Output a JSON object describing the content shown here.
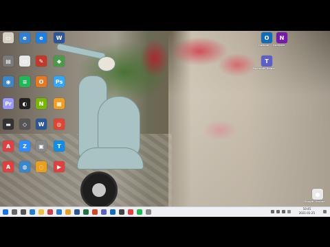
{
  "desktop": {
    "icons_left": [
      {
        "name": "app-icon-1",
        "label": "",
        "color": "#d8d2c6",
        "glyph": "▭"
      },
      {
        "name": "app-icon-2",
        "label": "",
        "color": "#2f7fd3",
        "glyph": "e"
      },
      {
        "name": "app-icon-3",
        "label": "",
        "color": "#1e7fe0",
        "glyph": "e"
      },
      {
        "name": "app-icon-4",
        "label": "",
        "color": "#2b579a",
        "glyph": "W"
      },
      {
        "name": "app-icon-5",
        "label": "",
        "color": "#7a7a7a",
        "glyph": "▤"
      },
      {
        "name": "app-icon-6",
        "label": "",
        "color": "#e8e8e8",
        "glyph": "▭"
      },
      {
        "name": "app-icon-7",
        "label": "",
        "color": "#c0392b",
        "glyph": "✎"
      },
      {
        "name": "app-icon-8",
        "label": "",
        "color": "#4a9a4a",
        "glyph": "◆"
      },
      {
        "name": "app-icon-9",
        "label": "",
        "color": "#3a86c8",
        "glyph": "◉"
      },
      {
        "name": "app-icon-10",
        "label": "",
        "color": "#1db954",
        "glyph": "≡"
      },
      {
        "name": "app-icon-11",
        "label": "",
        "color": "#e87722",
        "glyph": "O"
      },
      {
        "name": "app-icon-12",
        "label": "",
        "color": "#31a8ff",
        "glyph": "Ps"
      },
      {
        "name": "app-icon-13",
        "label": "",
        "color": "#9999ff",
        "glyph": "Pr"
      },
      {
        "name": "app-icon-14",
        "label": "",
        "color": "#222",
        "glyph": "◐"
      },
      {
        "name": "app-icon-15",
        "label": "",
        "color": "#76b900",
        "glyph": "N"
      },
      {
        "name": "app-icon-16",
        "label": "",
        "color": "#f0a020",
        "glyph": "▦"
      },
      {
        "name": "app-icon-17",
        "label": "",
        "color": "#333",
        "glyph": "▬"
      },
      {
        "name": "app-icon-18",
        "label": "",
        "color": "#555",
        "glyph": "◇"
      },
      {
        "name": "app-icon-19",
        "label": "",
        "color": "#2b579a",
        "glyph": "W"
      },
      {
        "name": "app-icon-20",
        "label": "",
        "color": "#e0452f",
        "glyph": "◎"
      },
      {
        "name": "app-icon-21",
        "label": "",
        "color": "#e04040",
        "glyph": "A"
      },
      {
        "name": "app-icon-22",
        "label": "",
        "color": "#2d8cff",
        "glyph": "Z"
      },
      {
        "name": "app-icon-23",
        "label": "",
        "color": "#888",
        "glyph": "▣"
      },
      {
        "name": "app-icon-24",
        "label": "",
        "color": "#0e8ee9",
        "glyph": "T"
      },
      {
        "name": "app-icon-25",
        "label": "",
        "color": "#e04040",
        "glyph": "A"
      },
      {
        "name": "app-icon-26",
        "label": "",
        "color": "#3a86c8",
        "glyph": "◍"
      },
      {
        "name": "app-icon-27",
        "label": "",
        "color": "#e8a020",
        "glyph": "◌"
      },
      {
        "name": "app-icon-28",
        "label": "",
        "color": "#e04040",
        "glyph": "▶"
      }
    ],
    "icons_right": [
      {
        "name": "outlook-icon",
        "label": "Outlook",
        "color": "#0f6cbd",
        "glyph": "O"
      },
      {
        "name": "onenote-icon",
        "label": "OneNote",
        "color": "#7719aa",
        "glyph": "N"
      },
      {
        "name": "teams-icon",
        "label": "Microsoft Teams",
        "color": "#5b5fc7",
        "glyph": "T"
      },
      {
        "name": "chrome-icon",
        "label": "Google Chrome",
        "color": "#e8e8e8",
        "glyph": "●"
      }
    ]
  },
  "taskbar": {
    "apps": [
      {
        "name": "start-icon",
        "color": "#1a73e8"
      },
      {
        "name": "search-icon",
        "color": "#666"
      },
      {
        "name": "taskview-icon",
        "color": "#555"
      },
      {
        "name": "edge-icon",
        "color": "#1e7fe0"
      },
      {
        "name": "explorer-icon",
        "color": "#f0c040"
      },
      {
        "name": "store-icon",
        "color": "#d04040"
      },
      {
        "name": "mail-icon",
        "color": "#2b7cd3"
      },
      {
        "name": "chrome-taskbar-icon",
        "color": "#e8a020"
      },
      {
        "name": "word-taskbar-icon",
        "color": "#2b579a"
      },
      {
        "name": "excel-taskbar-icon",
        "color": "#217346"
      },
      {
        "name": "powerpoint-taskbar-icon",
        "color": "#d24726"
      },
      {
        "name": "teams-taskbar-icon",
        "color": "#5b5fc7"
      },
      {
        "name": "outlook-taskbar-icon",
        "color": "#0f6cbd"
      },
      {
        "name": "app-taskbar-icon-1",
        "color": "#444"
      },
      {
        "name": "app-taskbar-icon-2",
        "color": "#e04040"
      },
      {
        "name": "app-taskbar-icon-3",
        "color": "#1db954"
      },
      {
        "name": "app-taskbar-icon-4",
        "color": "#888"
      }
    ],
    "clock": {
      "time": "10:45",
      "date": "2021-01-25"
    }
  }
}
